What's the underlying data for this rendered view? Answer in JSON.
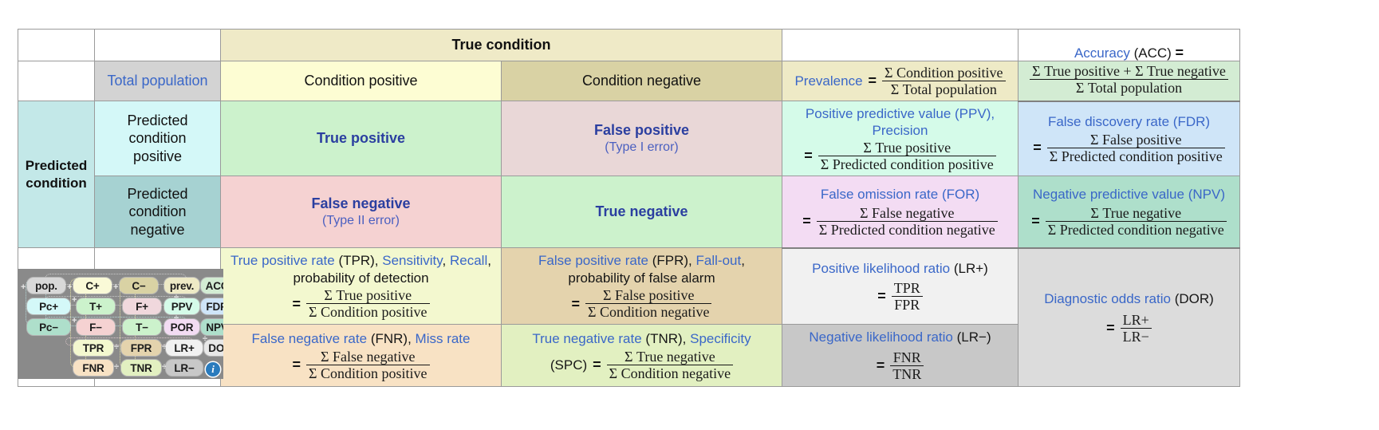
{
  "headers": {
    "true_condition": "True condition",
    "total_population": "Total population",
    "condition_positive": "Condition positive",
    "condition_negative": "Condition negative",
    "predicted_condition": "Predicted\ncondition",
    "predicted_condition_line1": "Predicted",
    "predicted_condition_line2": "condition",
    "predicted_condition_positive": "Predicted\ncondition\npositive",
    "predicted_condition_negative": "Predicted\ncondition\nnegative"
  },
  "cells": {
    "prevalence": {
      "name": "Prevalence",
      "eq": "=",
      "numerator": "Σ Condition positive",
      "denominator": "Σ Total population"
    },
    "accuracy": {
      "name": "Accuracy",
      "abbr": "(ACC)",
      "eq": "=",
      "numerator": "Σ True positive + Σ True negative",
      "denominator": "Σ Total population"
    },
    "true_positive": {
      "label": "True positive"
    },
    "false_positive": {
      "label": "False positive",
      "sub": "(Type I error)"
    },
    "false_negative": {
      "label": "False negative",
      "sub": "(Type II error)"
    },
    "true_negative": {
      "label": "True negative"
    },
    "ppv": {
      "name": "Positive predictive value",
      "abbr": "(PPV),",
      "alt": "Precision",
      "eq": "=",
      "numerator": "Σ True positive",
      "denominator": "Σ Predicted condition positive"
    },
    "fdr": {
      "name": "False discovery rate",
      "abbr": "(FDR)",
      "eq": "=",
      "numerator": "Σ False positive",
      "denominator": "Σ Predicted condition positive"
    },
    "for": {
      "name": "False omission rate",
      "abbr": "(FOR)",
      "eq": "=",
      "numerator": "Σ False negative",
      "denominator": "Σ Predicted condition negative"
    },
    "npv": {
      "name": "Negative predictive value",
      "abbr": "(NPV)",
      "eq": "=",
      "numerator": "Σ True negative",
      "denominator": "Σ Predicted condition negative"
    },
    "tpr": {
      "name": "True positive rate",
      "abbr": "(TPR),",
      "alt1": "Sensitivity",
      "alt2": "Recall",
      "alt3": "probability of detection",
      "eq": "=",
      "numerator": "Σ True positive",
      "denominator": "Σ Condition positive"
    },
    "fpr": {
      "name": "False positive rate",
      "abbr": "(FPR),",
      "alt1": "Fall-out",
      "alt3": "probability of false alarm",
      "eq": "=",
      "numerator": "Σ False positive",
      "denominator": "Σ Condition negative"
    },
    "lr_plus": {
      "name": "Positive likelihood ratio",
      "abbr": "(LR+)",
      "eq": "=",
      "numerator": "TPR",
      "denominator": "FPR"
    },
    "dor": {
      "name": "Diagnostic odds ratio",
      "abbr": "(DOR)",
      "eq": "=",
      "numerator": "LR+",
      "denominator": "LR−"
    },
    "fnr": {
      "name": "False negative rate",
      "abbr": "(FNR),",
      "alt1": "Miss rate",
      "eq": "=",
      "numerator": "Σ False negative",
      "denominator": "Σ Condition positive"
    },
    "tnr": {
      "name": "True negative rate",
      "abbr": "(TNR),",
      "alt1": "Specificity",
      "spc": "(SPC)",
      "eq": "=",
      "numerator": "Σ True negative",
      "denominator": "Σ Condition negative"
    },
    "lr_minus": {
      "name": "Negative likelihood ratio",
      "abbr": "(LR−)",
      "eq": "=",
      "numerator": "FNR",
      "denominator": "TNR"
    }
  },
  "legend": {
    "rows": [
      {
        "chips": [
          "pop.",
          "C+",
          "C−",
          "prev.",
          "ACC"
        ]
      },
      {
        "chips": [
          "Pc+",
          "T+",
          "F+",
          "PPV",
          "FDR"
        ]
      },
      {
        "chips": [
          "Pc−",
          "F−",
          "T−",
          "POR",
          "NPV"
        ]
      },
      {
        "chips": [
          "TPR",
          "FPR",
          "LR+",
          "DOR"
        ]
      },
      {
        "chips": [
          "FNR",
          "TNR",
          "LR−"
        ]
      }
    ],
    "operators": {
      "plus": "+",
      "divide": "÷"
    },
    "info_glyph": "i"
  },
  "colors": {
    "true_condition_header": "#efeac7",
    "condition_positive": "#fdfdd3",
    "condition_negative": "#d9d2a4",
    "total_population": "#d3d3d3",
    "prevalence": "#eeeac6",
    "accuracy": "#d3ecd3",
    "predicted_condition": "#c3e8e8",
    "true_positive": "#ccf2cc",
    "false_positive": "#e9d7d7",
    "false_negative": "#f5d2d2",
    "true_negative": "#ccf2cc",
    "ppv": "#d5fbe9",
    "fdr": "#cfe5f8",
    "for": "#f3dcf3",
    "npv": "#aedfcb",
    "tpr": "#f3f8cf",
    "fpr": "#e4d3ad",
    "fnr": "#f8e2c4",
    "tnr": "#e2f0c1",
    "lr_plus": "#f1f1f1",
    "lr_minus": "#c8c8c8",
    "dor": "#dcdcdc",
    "text_blue": "#2b3fa0",
    "text_light_blue": "#3a67c8",
    "info_badge": "#2a7bbd"
  }
}
